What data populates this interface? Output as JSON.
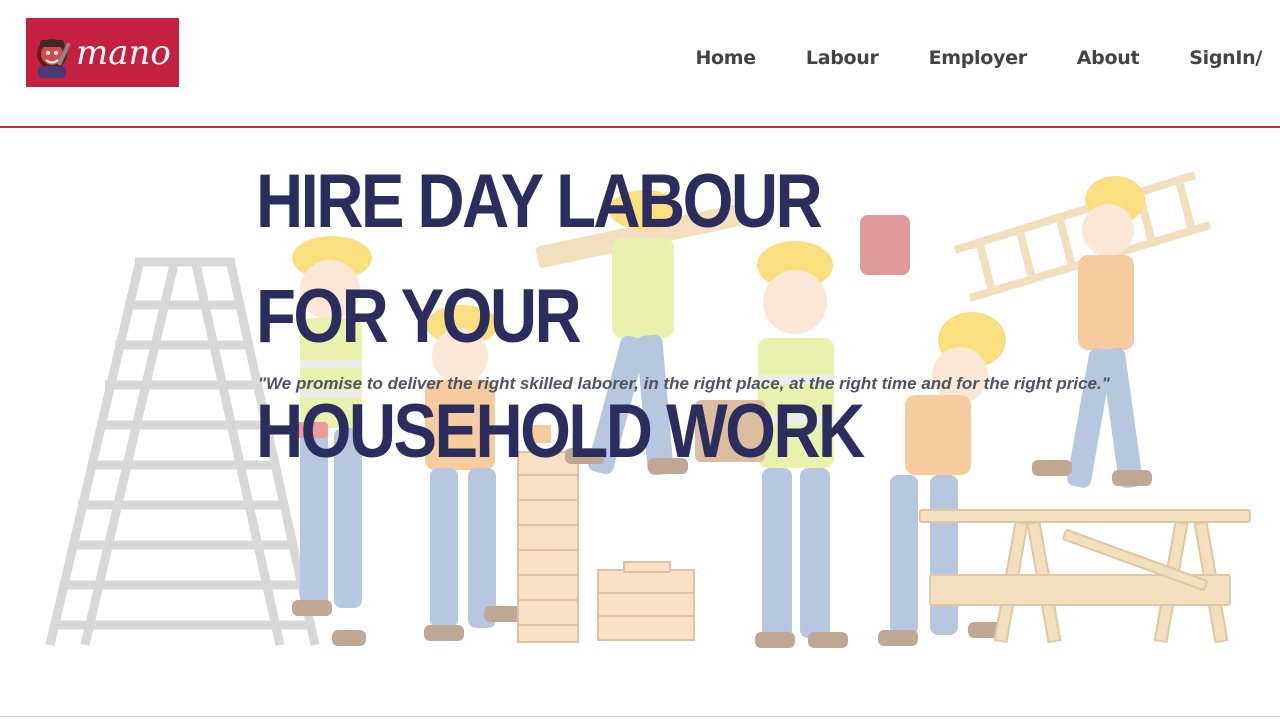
{
  "brand": {
    "logo_text": "mano",
    "logo_color": "#c3213f",
    "mascot_icon": "worker-mascot-icon"
  },
  "nav": {
    "items": [
      {
        "label": "Home"
      },
      {
        "label": "Labour"
      },
      {
        "label": "Employer"
      },
      {
        "label": "About"
      },
      {
        "label": "SignIn/"
      }
    ],
    "divider_color": "#cc2a34"
  },
  "hero": {
    "title_line1": "HIRE DAY LABOUR FOR YOUR",
    "title_line2": "HOUSEHOLD WORK",
    "tagline": "\"We promise to deliver the right skilled laborer, in the right place, at the right time and for the right price.\"",
    "title_color": "#2b2d5e",
    "illustration": "construction-workers-illustration"
  }
}
